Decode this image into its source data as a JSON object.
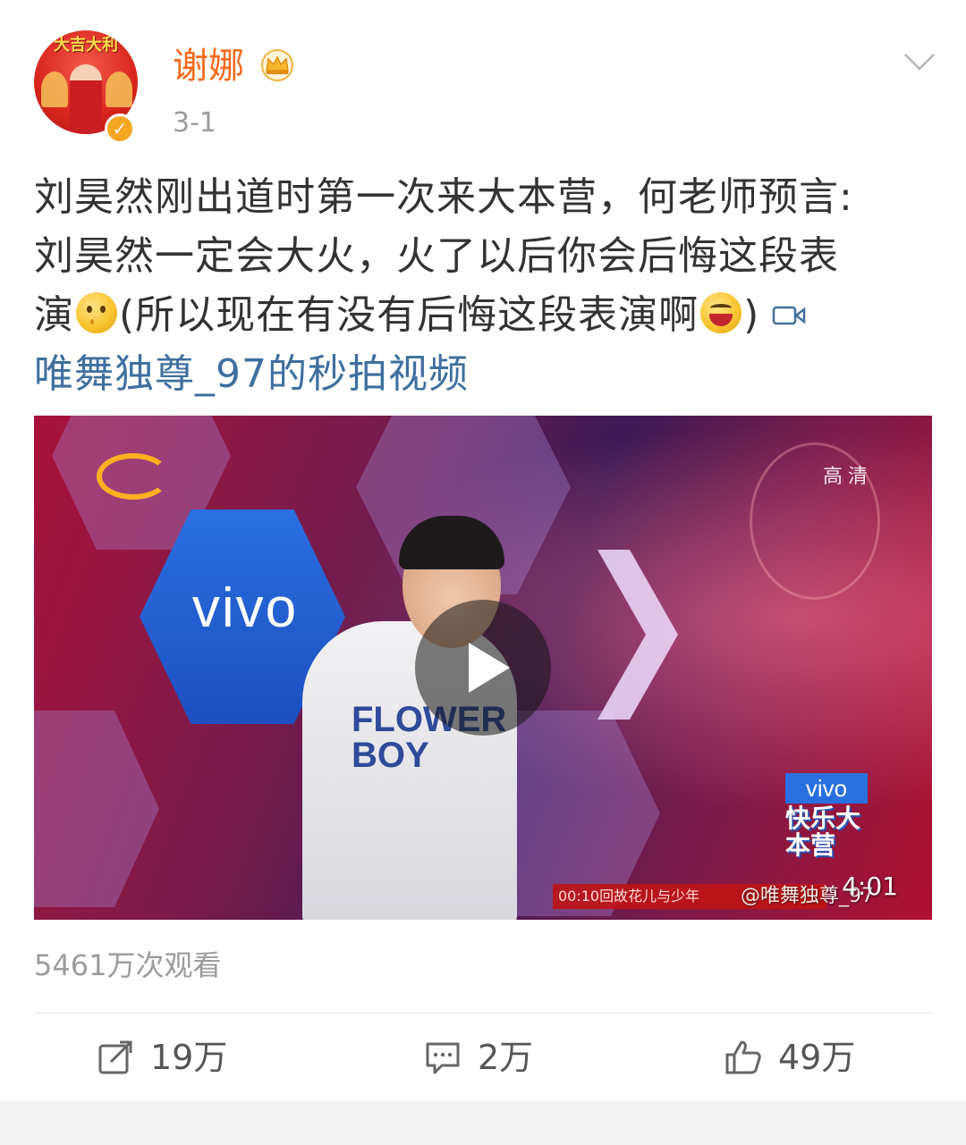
{
  "post": {
    "author": "谢娜",
    "time": "3-1",
    "text_line1": "刘昊然刚出道时第一次来大本营，何老师预言:",
    "text_line2": "刘昊然一定会大火，火了以后你会后悔这段表",
    "text_line3_a": "演",
    "text_line3_b": "(所以现在有没有后悔这段表演啊",
    "text_line3_c": ")",
    "link_text": "唯舞独尊_97的秒拍视频",
    "avatar_banner": "大吉大利"
  },
  "video": {
    "hd_label": "高清",
    "vivo_logo": "vivo",
    "vivo_badge": "vivo",
    "show_logo": "快乐大本营",
    "shirt_print": "FLOWER BOY",
    "ticker": "00:10回故花儿与少年",
    "watermark": "@唯舞独尊_97",
    "duration": "4:01"
  },
  "stats": {
    "views": "5461万次观看",
    "reposts": "19万",
    "comments": "2万",
    "likes": "49万"
  },
  "colors": {
    "username": "#f26b1d",
    "link": "#3f6f9e",
    "meta_gray": "#9b9b9b",
    "badge": "#f5a623"
  },
  "icons": {
    "avatar": "avatar-image",
    "verify": "verified-badge-icon",
    "crown": "crown-icon",
    "more": "chevron-down-icon",
    "video": "video-camera-icon",
    "play": "play-icon",
    "repost": "repost-icon",
    "comment": "comment-icon",
    "like": "thumbs-up-icon"
  }
}
